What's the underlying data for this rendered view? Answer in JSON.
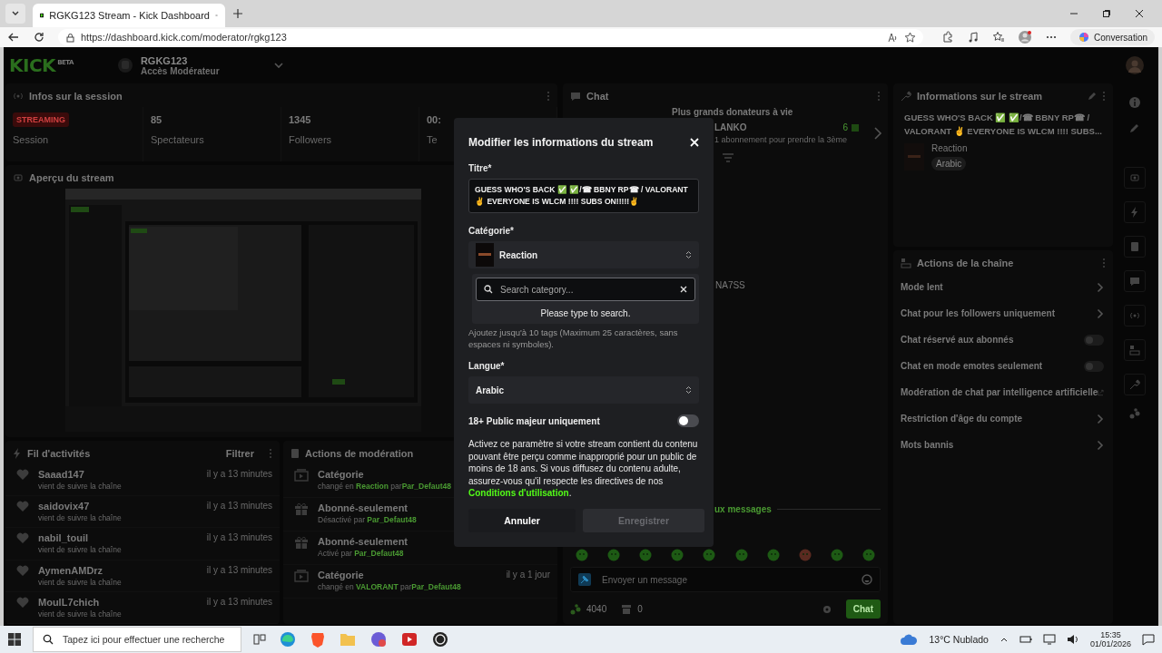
{
  "browser": {
    "tab_title": "RGKG123 Stream - Kick Dashboard",
    "url": "https://dashboard.kick.com/moderator/rgkg123",
    "side_button": "Conversation"
  },
  "header": {
    "logo": "KICK",
    "logo_badge": "BETA",
    "channel": "RGKG123",
    "role": "Accès Modérateur"
  },
  "session": {
    "title": "Infos sur la session",
    "stats": [
      {
        "kind": "badge",
        "value": "STREAMING",
        "label": "Session"
      },
      {
        "kind": "number",
        "value": "85",
        "label": "Spectateurs"
      },
      {
        "kind": "number",
        "value": "1345",
        "label": "Followers"
      },
      {
        "kind": "number",
        "value": "00:",
        "label": "Te"
      }
    ]
  },
  "preview": {
    "title": "Aperçu du stream"
  },
  "activity": {
    "title": "Fil d'activités",
    "filter": "Filtrer",
    "items": [
      {
        "user": "Saaad147",
        "action": "vient de suivre la chaîne",
        "time": "il y a 13 minutes"
      },
      {
        "user": "saidovix47",
        "action": "vient de suivre la chaîne",
        "time": "il y a 13 minutes"
      },
      {
        "user": "nabil_touil",
        "action": "vient de suivre la chaîne",
        "time": "il y a 13 minutes"
      },
      {
        "user": "AymenAMDrz",
        "action": "vient de suivre la chaîne",
        "time": "il y a 13 minutes"
      },
      {
        "user": "MoulL7chich",
        "action": "vient de suivre la chaîne",
        "time": "il y a 13 minutes"
      }
    ]
  },
  "moderation": {
    "title": "Actions de modération",
    "items": [
      {
        "kind": "category",
        "title": "Catégorie",
        "action": "changé en",
        "value": "Reaction",
        "by": "par",
        "user": "Par_Defaut48"
      },
      {
        "kind": "subscribers",
        "title": "Abonné-seulement",
        "action": "Désactivé par",
        "user": "Par_Defaut48"
      },
      {
        "kind": "subscribers",
        "title": "Abonné-seulement",
        "action": "Activé par",
        "user": "Par_Defaut48"
      },
      {
        "kind": "category",
        "title": "Catégorie",
        "action": "changé en",
        "value": "VALORANT",
        "by": "par",
        "user": "Par_Defaut48",
        "time": "il y a 1 jour"
      }
    ]
  },
  "chat": {
    "title": "Chat",
    "top_donors": "Plus grands donateurs à vie",
    "donor_name": "LANKO",
    "donor_count": "6",
    "donor_note": "1 abonnement pour prendre la 3ème",
    "mention": "NA7SS",
    "new_messages": "ux messages",
    "input_placeholder": "Envoyer un message",
    "points": "4040",
    "count": "0",
    "send": "Chat"
  },
  "stream_info": {
    "title": "Informations sur le stream",
    "stream_title": "GUESS WHO'S BACK ✅ ✅/☎ BBNY RP☎ / VALORANT ✌ EVERYONE IS WLCM !!!! SUBS...",
    "category": "Reaction",
    "language": "Arabic"
  },
  "channel_actions": {
    "title": "Actions de la chaîne",
    "items": [
      {
        "kind": "link",
        "label": "Mode lent"
      },
      {
        "kind": "link",
        "label": "Chat pour les followers uniquement"
      },
      {
        "kind": "toggle",
        "label": "Chat réservé aux abonnés",
        "on": false
      },
      {
        "kind": "toggle",
        "label": "Chat en mode emotes seulement",
        "on": false
      },
      {
        "kind": "external",
        "label": "Modération de chat par intelligence artificielle"
      },
      {
        "kind": "link",
        "label": "Restriction d'âge du compte"
      },
      {
        "kind": "link",
        "label": "Mots bannis"
      }
    ]
  },
  "modal": {
    "title": "Modifier les informations du stream",
    "title_label": "Titre*",
    "title_value": "GUESS WHO'S BACK ✅ ✅/☎ BBNY RP☎ / VALORANT ✌ EVERYONE IS WLCM !!!! SUBS ON!!!!!✌",
    "category_label": "Catégorie*",
    "category_value": "Reaction",
    "search": {
      "placeholder": "Search category..."
    },
    "search_hint": "Please type to search.",
    "tags_help": "Ajoutez jusqu'à 10 tags (Maximum 25 caractères, sans espaces ni symboles).",
    "language_label": "Langue*",
    "language_value": "Arabic",
    "mature_label": "18+ Public majeur uniquement",
    "mature_on": false,
    "mature_help": "Activez ce paramètre si votre stream contient du contenu pouvant être perçu comme inapproprié pour un public de moins de 18 ans. Si vous diffusez du contenu adulte, assurez-vous qu'il respecte les directives de nos",
    "terms_link": "Conditions d'utilisation",
    "terms_end": ".",
    "cancel": "Annuler",
    "save": "Enregistrer",
    "save_disabled": true
  },
  "taskbar": {
    "search_placeholder": "Tapez ici pour effectuer une recherche",
    "weather": "13°C Nublado",
    "time": "15:35",
    "date": "01/01/2026"
  }
}
